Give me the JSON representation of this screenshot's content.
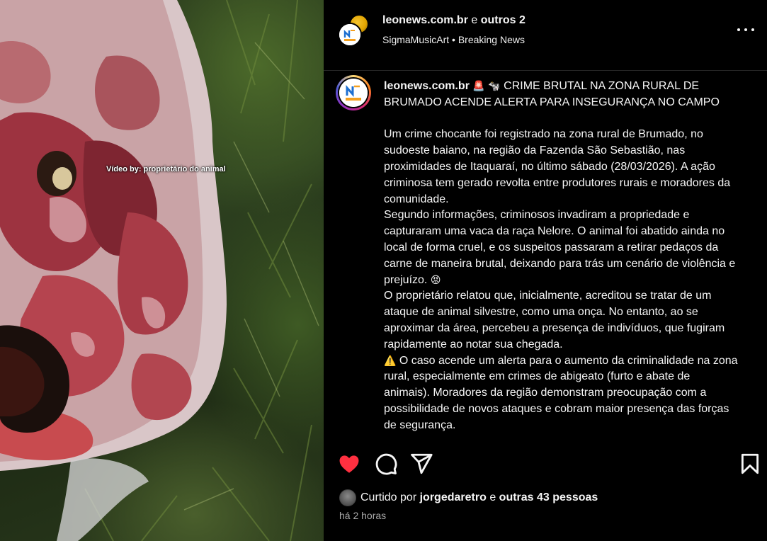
{
  "media": {
    "caption": "Vídeo by: proprietário do animal"
  },
  "header": {
    "account": "leonews.com.br",
    "and_text": "e",
    "others": "outros 2",
    "subline_a": "SigmaMusicArt",
    "subline_sep": "•",
    "subline_b": "Breaking News",
    "more_icon": "more-horizontal-icon"
  },
  "post": {
    "username": "leonews.com.br",
    "emoji_1": "🚨",
    "emoji_2": "🐄",
    "headline": "CRIME BRUTAL NA ZONA RURAL DE BRUMADO ACENDE ALERTA PARA INSEGURANÇA NO CAMPO",
    "para_1": "Um crime chocante foi registrado na zona rural de Brumado, no sudoeste baiano, na região da Fazenda São Sebastião, nas proximidades de Itaquaraí, no último sábado (28/03/2026). A ação criminosa tem gerado revolta entre produtores rurais e moradores da comunidade.",
    "para_2": "Segundo informações, criminosos invadiram a propriedade e capturaram uma vaca da raça Nelore. O animal foi abatido ainda no local de forma cruel, e os suspeitos passaram a retirar pedaços da carne de maneira brutal, deixando para trás um cenário de violência e prejuízo.",
    "para_2_emoji": "😡",
    "para_3": "O proprietário relatou que, inicialmente, acreditou se tratar de um ataque de animal silvestre, como uma onça. No entanto, ao se aproximar da área, percebeu a presença de indivíduos, que fugiram rapidamente ao notar sua chegada.",
    "para_4_emoji": "⚠️",
    "para_4": "O caso acende um alerta para o aumento da criminalidade na zona rural, especialmente em crimes de abigeato (furto e abate de animais). Moradores da região demonstram preocupação com a possibilidade de novos ataques e cobram maior presença das forças de segurança."
  },
  "actions": {
    "like_icon": "heart-filled-icon",
    "comment_icon": "comment-icon",
    "share_icon": "share-icon",
    "save_icon": "bookmark-icon",
    "like_color": "#ff3040"
  },
  "likes": {
    "prefix": "Curtido por",
    "user": "jorgedaretro",
    "and_text": "e",
    "others": "outras 43 pessoas"
  },
  "time": "há 2 horas"
}
